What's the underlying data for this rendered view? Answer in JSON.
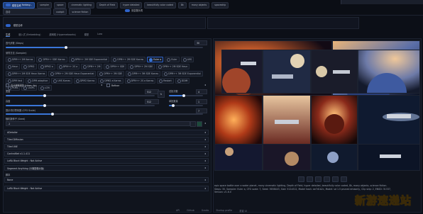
{
  "topbar": {
    "checkpoint_label": "模型名称",
    "checkpoint_value": "fantasy...",
    "vae_value": "自动",
    "tags": [
      "sampler",
      "space",
      "cinematic lighting",
      "Depth of Field",
      "hyper detailed",
      "beautifully color coded",
      "8k",
      "many objects",
      "spaceship",
      "cockpit",
      "science fiction"
    ],
    "toggle_label": "清空提示词"
  },
  "tabs": [
    "生成",
    "嵌入式 (Embedding)",
    "超网络 (Hypernetworks)",
    "模型",
    "Lora"
  ],
  "sampling": {
    "steps_label": "迭代步数 (Steps)",
    "steps_value": "30",
    "method_label": "采样方法 (Sampler)",
    "options": [
      "DPM++ 2M Karras",
      "DPM++ SDE Karras",
      "DPM++ 2M SDE Exponential",
      "DPM++ 2M SDE Karras",
      "Euler a",
      "Euler",
      "LMS",
      "Heun",
      "DPM2",
      "DPM2 a",
      "DPM++ 2S a",
      "DPM++ 2M",
      "DPM++ SDE",
      "DPM++ 2M SDE",
      "DPM++ 2M SDE Heun",
      "DPM++ 2M SDE Heun Karras",
      "DPM++ 2M SDE Heun Exponential",
      "DPM++ 3M SDE",
      "DPM++ 3M SDE Karras",
      "DPM++ 3M SDE Exponential",
      "DPM fast",
      "DPM adaptive",
      "LMS Karras",
      "DPM2 Karras",
      "DPM2 a Karras",
      "DPM++ 2S a Karras",
      "Restart",
      "DDIM",
      "PLMS",
      "UniPC",
      "LCM"
    ],
    "selected": "Euler a"
  },
  "hires": {
    "label": "高分辨率修复 (Hires. fix)",
    "refiner_label": "Refiner"
  },
  "dims": {
    "width_label": "宽度",
    "width_value": "512",
    "height_label": "高度",
    "height_value": "512",
    "batch_count_label": "总批次数",
    "batch_count_value": "4",
    "batch_size_label": "单批数量",
    "batch_size_value": "1",
    "cfg_label": "提示词引导系数 (CFG Scale)",
    "cfg_value": "7",
    "seed_label": "随机数种子 (Seed)",
    "seed_value": "-1"
  },
  "accordions": [
    "ADetailer",
    "Tiled Diffusion",
    "Tiled VAE",
    "ControlNet v1.1.411",
    "LoRA Block Weight : Not Active",
    "Segment Anything (分离图像对象)"
  ],
  "script": {
    "label": "脚本",
    "value": "None",
    "bottom_accordion": "LoRA Block Weight : Not Active"
  },
  "gallery": {
    "output_text": "epic space battle over a water planet, many cinematic lighting, Depth of Field, hyper detailed, beautifully color coded, 8k, many objects, science fiction. Steps: 30, Sampler: Euler a, CFG scale: 7, Seed: 3658443, Size: 512x512, Model hash: ae7d1b2c, Model: sd 1.5 pruned emaonly, Clip skip: 2, ENSD: 31337, Version: v1.6.0",
    "tool_icons": [
      "folder-icon",
      "save-icon",
      "zip-icon",
      "send-img2img-icon",
      "send-inpaint-icon",
      "send-extras-icon"
    ]
  },
  "footer": [
    "API",
    "Github",
    "Gradio",
    "Startup profile",
    "重载 UI"
  ],
  "watermark": "新游速递站"
}
